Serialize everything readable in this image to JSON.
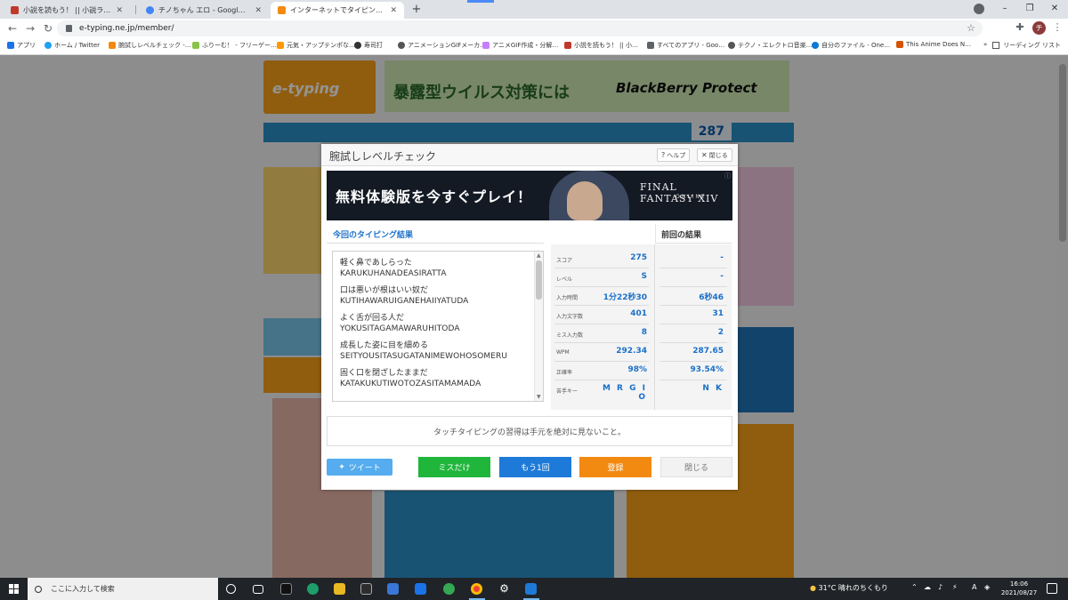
{
  "browser": {
    "tabs": [
      {
        "title": "小説を読もう！ || 小説ランキング[累…",
        "color": "#c0392b"
      },
      {
        "title": "チノちゃん エロ - Google 検索",
        "color": "#4285f4"
      },
      {
        "title": "インターネットでタイピング練習 イータ…",
        "color": "#f28a12"
      }
    ],
    "new_tab": "+",
    "url": "e-typing.ne.jp/member/",
    "bookmarks": [
      "アプリ",
      "ホーム / Twitter",
      "腕試しレベルチェック -…",
      "ふりーむ！ - フリーゲー…",
      "元気・アップテンポな…",
      "寿司打",
      "アニメーションGIFメーカ…",
      "アニメGIF作成・分解…",
      "小説を読もう！ || 小…",
      "すべてのアプリ - Goo…",
      "テクノ・エレクトロ音楽…",
      "自分のファイル - One…",
      "This Anime Does N…"
    ],
    "bookmarks_more": "»",
    "reading_list": "リーディング リスト",
    "avatar_letter": "チ"
  },
  "background_page": {
    "logo": "e-typing",
    "ad_left": "暴露型ウイルス対策には",
    "ad_right": "BlackBerry Protect",
    "points": "287"
  },
  "modal": {
    "title": "腕試しレベルチェック",
    "help_label": "ヘルプ",
    "close_label": "閉じる",
    "ad_copy": "無料体験版を今すぐプレイ！",
    "ad_brand": "FINAL FANTASY XIV",
    "ad_brand_sub": "ONLINE",
    "current_header": "今回のタイピング結果",
    "previous_header": "前回の結果",
    "words": [
      {
        "jp": "軽く鼻であしらった",
        "romaji": "KARUKUHANADEASIRATTA"
      },
      {
        "jp": "口は悪いが根はいい奴だ",
        "romaji": "KUTIHAWARUIGANEHAIIYATUDA"
      },
      {
        "jp": "よく舌が回る人だ",
        "romaji": "YOKUSITAGAMAWARUHITODA"
      },
      {
        "jp": "成長した姿に目を細める",
        "romaji": "SEITYOUSITASUGATANIMEWOHOSOMERU"
      },
      {
        "jp": "固く口を閉ざしたままだ",
        "romaji": "KATAKUKUTIWOTOZASITAMAMADA"
      }
    ],
    "stats": [
      {
        "label": "スコア",
        "current": "275",
        "previous": "-"
      },
      {
        "label": "レベル",
        "current": "S",
        "previous": "-"
      },
      {
        "label": "入力時間",
        "current": "1分22秒30",
        "previous": "6秒46"
      },
      {
        "label": "入力文字数",
        "current": "401",
        "previous": "31"
      },
      {
        "label": "ミス入力数",
        "current": "8",
        "previous": "2"
      },
      {
        "label": "WPM",
        "current": "292.34",
        "previous": "287.65"
      },
      {
        "label": "正確率",
        "current": "98%",
        "previous": "93.54%"
      },
      {
        "label": "苦手キー",
        "current": "M R G I O",
        "previous": "N K"
      }
    ],
    "tip": "タッチタイピングの習得は手元を絶対に見ないこと。",
    "buttons": {
      "tweet": "ツイート",
      "miss_only": "ミスだけ",
      "again": "もう1回",
      "register": "登録",
      "close": "閉じる"
    }
  },
  "taskbar": {
    "search_placeholder": "ここに入力して検索",
    "weather": "31°C 晴れのちくもり",
    "ime": "A",
    "time": "16:06",
    "date": "2021/08/27"
  },
  "colors": {
    "accent_blue": "#1a70c9",
    "green": "#1fb63b",
    "blue_btn": "#1e7ad8",
    "orange": "#f28a12",
    "twitter": "#55acee"
  }
}
